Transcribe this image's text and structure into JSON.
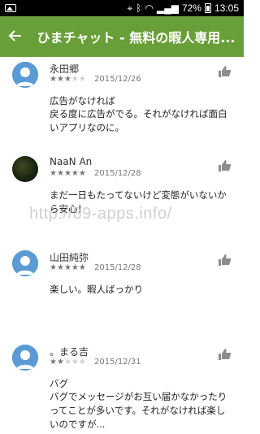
{
  "statusbar": {
    "battery": "72%",
    "time": "13:05"
  },
  "appbar": {
    "title": "ひまチャット - 無料の暇人専用..."
  },
  "reviews": [
    {
      "author": "永田郷",
      "rating": 3,
      "date": "2015/12/26",
      "title": "広告がなければ",
      "body": "戻る度に広告がでる。それがなければ面白いアプリなのに。"
    },
    {
      "author": "NaaN An",
      "rating": 5,
      "date": "2015/12/28",
      "title": "",
      "body": "まだ一日もたってないけど変態がいないから安心！"
    },
    {
      "author": "山田純弥",
      "rating": 5,
      "date": "2015/12/28",
      "title": "",
      "body": "楽しい。暇人ばっかり"
    },
    {
      "author": "。まる吉",
      "rating": 2,
      "date": "2015/12/31",
      "title": "バグ",
      "body": "バグでメッセージがお互い届かなかったりってことが多いです。それがなければ楽しいのですが..."
    }
  ],
  "watermark": "http://89-apps.info/",
  "colors": {
    "appbar": "#689f38",
    "avatar": "#4a90e2",
    "statusbar": "#000000"
  }
}
